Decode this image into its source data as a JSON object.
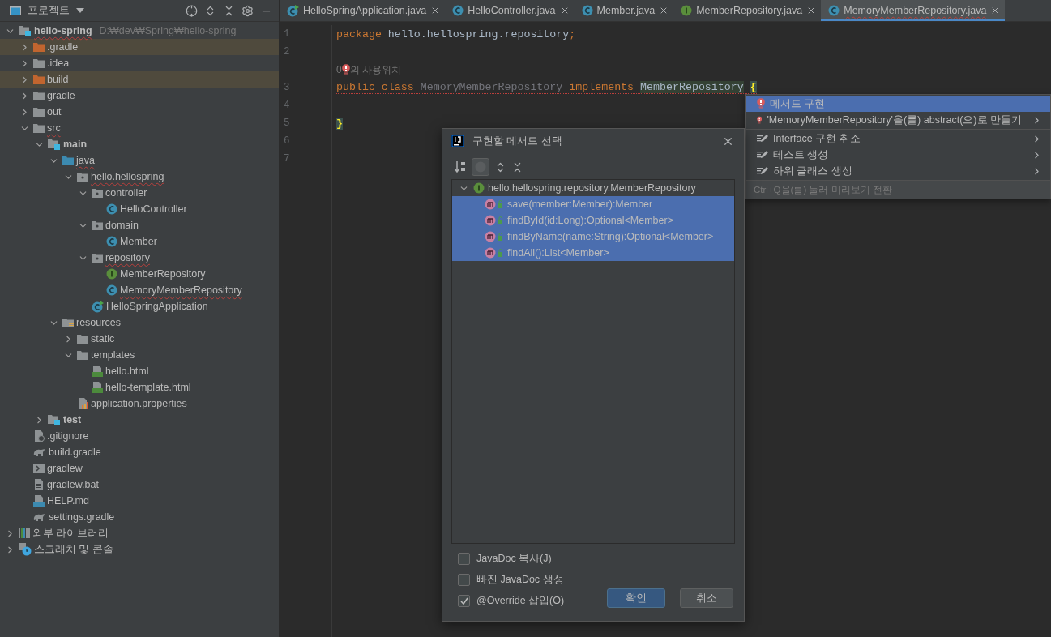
{
  "project_panel": {
    "title": "프로젝트",
    "tree": [
      {
        "label": "hello-spring",
        "path": "D:₩dev₩Spring₩hello-spring",
        "kind": "module",
        "error": true,
        "expanded": true,
        "children": [
          {
            "label": ".gradle",
            "kind": "excluded-folder",
            "expanded": false
          },
          {
            "label": ".idea",
            "kind": "folder",
            "expanded": false
          },
          {
            "label": "build",
            "kind": "excluded-folder",
            "expanded": false
          },
          {
            "label": "gradle",
            "kind": "folder",
            "expanded": false
          },
          {
            "label": "out",
            "kind": "folder",
            "expanded": false
          },
          {
            "label": "src",
            "kind": "folder",
            "error": true,
            "expanded": true,
            "children": [
              {
                "label": "main",
                "kind": "source-root",
                "expanded": true,
                "children": [
                  {
                    "label": "java",
                    "kind": "source-folder",
                    "error": true,
                    "expanded": true,
                    "children": [
                      {
                        "label": "hello.hellospring",
                        "kind": "package",
                        "error": true,
                        "expanded": true,
                        "children": [
                          {
                            "label": "controller",
                            "kind": "package",
                            "expanded": true,
                            "children": [
                              {
                                "label": "HelloController",
                                "kind": "class"
                              }
                            ]
                          },
                          {
                            "label": "domain",
                            "kind": "package",
                            "expanded": true,
                            "children": [
                              {
                                "label": "Member",
                                "kind": "class"
                              }
                            ]
                          },
                          {
                            "label": "repository",
                            "kind": "package",
                            "error": true,
                            "expanded": true,
                            "children": [
                              {
                                "label": "MemberRepository",
                                "kind": "interface"
                              },
                              {
                                "label": "MemoryMemberRepository",
                                "kind": "class",
                                "error": true
                              }
                            ]
                          },
                          {
                            "label": "HelloSpringApplication",
                            "kind": "app"
                          }
                        ]
                      }
                    ]
                  },
                  {
                    "label": "resources",
                    "kind": "resources",
                    "expanded": true,
                    "children": [
                      {
                        "label": "static",
                        "kind": "folder",
                        "expanded": false
                      },
                      {
                        "label": "templates",
                        "kind": "folder",
                        "expanded": true,
                        "children": [
                          {
                            "label": "hello.html",
                            "kind": "html"
                          },
                          {
                            "label": "hello-template.html",
                            "kind": "html"
                          }
                        ]
                      },
                      {
                        "label": "application.properties",
                        "kind": "properties"
                      }
                    ]
                  }
                ]
              },
              {
                "label": "test",
                "kind": "source-root",
                "expanded": false
              }
            ]
          },
          {
            "label": ".gitignore",
            "kind": "gitignore"
          },
          {
            "label": "build.gradle",
            "kind": "gradle"
          },
          {
            "label": "gradlew",
            "kind": "shell"
          },
          {
            "label": "gradlew.bat",
            "kind": "text"
          },
          {
            "label": "HELP.md",
            "kind": "markdown"
          },
          {
            "label": "settings.gradle",
            "kind": "gradle"
          }
        ]
      },
      {
        "label": "외부 라이브러리",
        "kind": "libraries",
        "expanded": false
      },
      {
        "label": "스크래치 및 콘솔",
        "kind": "scratches",
        "expanded": false
      }
    ]
  },
  "tabs": [
    {
      "label": "HelloSpringApplication.java",
      "kind": "app",
      "selected": false,
      "error": false
    },
    {
      "label": "HelloController.java",
      "kind": "class",
      "selected": false,
      "error": false
    },
    {
      "label": "Member.java",
      "kind": "class",
      "selected": false,
      "error": false
    },
    {
      "label": "MemberRepository.java",
      "kind": "interface",
      "selected": false,
      "error": false
    },
    {
      "label": "MemoryMemberRepository.java",
      "kind": "class",
      "selected": true,
      "error": true
    }
  ],
  "editor": {
    "lines": [
      {
        "kind": "code",
        "number": "1",
        "tokens": [
          {
            "kind": "keyword",
            "text": "package"
          },
          {
            "kind": "plain",
            "text": " hello.hellospring.repository"
          },
          {
            "kind": "keyword",
            "text": ";"
          }
        ]
      },
      {
        "kind": "code",
        "number": "2"
      },
      {
        "kind": "hint",
        "before": "0",
        "after": "의 사용위치"
      },
      {
        "kind": "code",
        "number": "3",
        "error": true,
        "tokens": [
          {
            "kind": "keyword",
            "text": "public class "
          },
          {
            "kind": "unused",
            "text": "MemoryMemberRepository"
          },
          {
            "kind": "keyword",
            "text": " implements "
          },
          {
            "kind": "reference",
            "text": "MemberRepository"
          },
          {
            "kind": "brace",
            "text": "{"
          }
        ]
      },
      {
        "kind": "code",
        "number": "4"
      },
      {
        "kind": "code",
        "number": "5",
        "tokens": [
          {
            "kind": "brace",
            "text": "}"
          }
        ]
      },
      {
        "kind": "code",
        "number": "6"
      },
      {
        "kind": "code",
        "number": "7"
      }
    ]
  },
  "intention_menu": {
    "groups": [
      [
        {
          "kind": "error",
          "label": "메서드 구현",
          "submenu": false,
          "selected": true
        },
        {
          "kind": "error",
          "label": "'MemoryMemberRepository'을(를) abstract(으)로 만들기",
          "submenu": true,
          "selected": false
        }
      ],
      [
        {
          "kind": "edit",
          "label": "Interface 구현 취소",
          "submenu": true,
          "selected": false
        },
        {
          "kind": "edit",
          "label": "테스트 생성",
          "submenu": true,
          "selected": false
        },
        {
          "kind": "edit",
          "label": "하위 클래스 생성",
          "submenu": true,
          "selected": false
        }
      ]
    ],
    "footer": "Ctrl+Q을(를) 눌러 미리보기 전환"
  },
  "dialog": {
    "title": "구현할 메서드 선택",
    "interface": {
      "label": "hello.hellospring.repository.MemberRepository",
      "expanded": true
    },
    "methods": [
      {
        "label": "save(member:Member):Member",
        "selected": true
      },
      {
        "label": "findById(id:Long):Optional<Member>",
        "selected": true
      },
      {
        "label": "findByName(name:String):Optional<Member>",
        "selected": true
      },
      {
        "label": "findAll():List<Member>",
        "selected": true
      }
    ],
    "options": [
      {
        "label": "JavaDoc 복사(J)",
        "checked": false
      },
      {
        "label": "빠진 JavaDoc 생성",
        "checked": false
      },
      {
        "label": "@Override 삽입(O)",
        "checked": true
      }
    ],
    "buttons": [
      {
        "label": "확인",
        "default": true
      },
      {
        "label": "취소",
        "default": false
      }
    ]
  }
}
